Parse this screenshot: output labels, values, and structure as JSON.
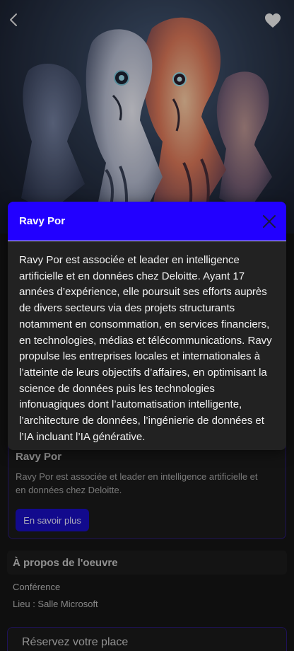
{
  "modal": {
    "title": "Ravy Por",
    "close_icon": "close-icon",
    "body": "Ravy Por est associée et leader en intelligence artificielle et en données chez Deloitte. Ayant 17 années d’expérience, elle poursuit ses efforts auprès de divers secteurs via des projets structurants notamment en consommation, en services financiers, en technologies, médias et télécommunications. Ravy propulse les entreprises locales et internationales à l’atteinte de leurs objectifs d’affaires, en optimisant la science de données puis les technologies infonuagiques dont l’automatisation intelligente, l’architecture de données, l’ingénierie de données et l’IA incluant l’IA générative.",
    "header_color": "#2200ff"
  },
  "header": {
    "back_icon": "chevron-left-icon",
    "favorite_icon": "heart-icon"
  },
  "speaker_card": {
    "name": "Ravy Por",
    "description": "Ravy Por est associée et leader en intelligence artificielle et en données chez Deloitte.",
    "button_label": "En savoir plus",
    "accent_color": "#1a0fc4"
  },
  "about": {
    "title": "À propos de l'oeuvre",
    "type": "Conférence",
    "place": "Lieu : Salle Microsoft"
  },
  "reserve": {
    "label": "Réservez votre place"
  }
}
